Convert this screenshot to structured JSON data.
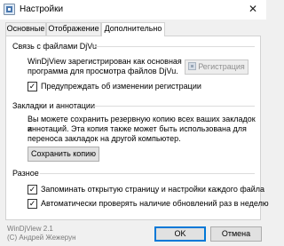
{
  "window": {
    "title": "Настройки",
    "close_symbol": "✕"
  },
  "tabs": [
    {
      "label": "Основные",
      "active": false
    },
    {
      "label": "Отображение",
      "active": false
    },
    {
      "label": "Дополнительно",
      "active": true
    }
  ],
  "djvu_section": {
    "title": "Связь с файлами DjVu",
    "line1": "WinDjView зарегистрирован как основная",
    "line2": "программа для просмотра файлов DjVu.",
    "register_button": "Регистрация",
    "register_icon": "shield-icon",
    "warn_checkbox": {
      "label": "Предупреждать об изменении регистрации",
      "checked": true
    }
  },
  "bookmarks_section": {
    "title": "Закладки и аннотации",
    "line1": "Вы можете сохранить резервную копию всех ваших закладок и",
    "line2": "аннотаций. Эта копия также может быть использована для",
    "line3": "переноса закладок на другой компьютер.",
    "save_button": "Сохранить копию"
  },
  "misc_section": {
    "title": "Разное",
    "remember_checkbox": {
      "label": "Запоминать открытую страницу и настройки каждого файла",
      "checked": true
    },
    "updates_checkbox": {
      "label": "Автоматически проверять наличие обновлений раз в неделю",
      "checked": true
    }
  },
  "footer": {
    "version": "WinDjView 2.1",
    "copyright": "(C) Андрей Жежерун",
    "ok_button": "OK",
    "cancel_button": "Отмена"
  },
  "colors": {
    "accent": "#0078d7",
    "window_bg": "#f0f0f0",
    "panel_bg": "#ffffff"
  }
}
